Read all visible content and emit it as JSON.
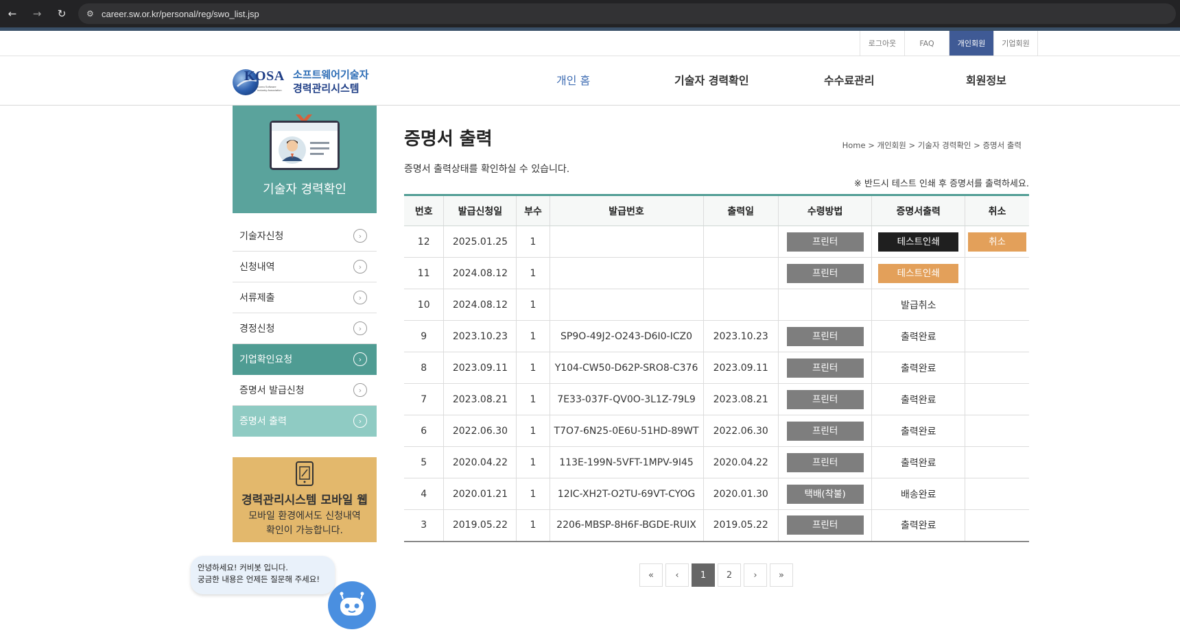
{
  "browser": {
    "back": "←",
    "forward": "→",
    "reload": "↻",
    "url": "career.sw.or.kr/personal/reg/swo_list.jsp"
  },
  "util": [
    {
      "label": "로그아웃",
      "active": false
    },
    {
      "label": "FAQ",
      "active": false
    },
    {
      "label": "개인회원",
      "active": true
    },
    {
      "label": "기업회원",
      "active": false
    }
  ],
  "logo": {
    "kosa": "KOSA",
    "kosa_sub1": "Korea Software",
    "kosa_sub2": "Industry Association",
    "line1": "소프트웨어기술자",
    "line2": "경력관리시스템"
  },
  "gnb": [
    "개인 홈",
    "기술자 경력확인",
    "수수료관리",
    "회원정보"
  ],
  "sidebar": {
    "title": "기술자 경력확인",
    "items": [
      {
        "label": "기술자신청"
      },
      {
        "label": "신청내역"
      },
      {
        "label": "서류제출"
      },
      {
        "label": "경정신청"
      },
      {
        "label": "기업확인요청"
      },
      {
        "label": "증명서 발급신청"
      },
      {
        "label": "증명서 출력"
      }
    ],
    "mobile_title": "경력관리시스템 모바일 웹",
    "mobile_desc1": "모바일 환경에서도 신청내역",
    "mobile_desc2": "확인이 가능합니다."
  },
  "chatbot": {
    "line1": "안녕하세요! 커비봇 입니다.",
    "line2": "궁금한 내용은 언제든 질문해 주세요!"
  },
  "main": {
    "title": "증명서 출력",
    "breadcrumb": "Home > 개인회원 > 기술자 경력확인 > 증명서 출력",
    "desc": "증명서 출력상태를 확인하실 수 있습니다.",
    "notice": "※ 반드시 테스트 인쇄 후 증명서를 출력하세요.",
    "columns": [
      "번호",
      "발급신청일",
      "부수",
      "발급번호",
      "출력일",
      "수령방법",
      "증명서출력",
      "취소"
    ],
    "rows": [
      {
        "no": "12",
        "date": "2025.01.25",
        "qty": "1",
        "issue_no": "",
        "print_date": "",
        "method": "프린터",
        "output": "테스트인쇄",
        "output_style": "black",
        "cancel": "취소"
      },
      {
        "no": "11",
        "date": "2024.08.12",
        "qty": "1",
        "issue_no": "",
        "print_date": "",
        "method": "프린터",
        "output": "테스트인쇄",
        "output_style": "orange",
        "cancel": ""
      },
      {
        "no": "10",
        "date": "2024.08.12",
        "qty": "1",
        "issue_no": "",
        "print_date": "",
        "method": "",
        "output": "발급취소",
        "output_style": "text",
        "cancel": ""
      },
      {
        "no": "9",
        "date": "2023.10.23",
        "qty": "1",
        "issue_no": "SP9O-49J2-O243-D6I0-ICZ0",
        "print_date": "2023.10.23",
        "method": "프린터",
        "output": "출력완료",
        "output_style": "text",
        "cancel": ""
      },
      {
        "no": "8",
        "date": "2023.09.11",
        "qty": "1",
        "issue_no": "Y104-CW50-D62P-SRO8-C376",
        "print_date": "2023.09.11",
        "method": "프린터",
        "output": "출력완료",
        "output_style": "text",
        "cancel": ""
      },
      {
        "no": "7",
        "date": "2023.08.21",
        "qty": "1",
        "issue_no": "7E33-037F-QV0O-3L1Z-79L9",
        "print_date": "2023.08.21",
        "method": "프린터",
        "output": "출력완료",
        "output_style": "text",
        "cancel": ""
      },
      {
        "no": "6",
        "date": "2022.06.30",
        "qty": "1",
        "issue_no": "T7O7-6N25-0E6U-51HD-89WT",
        "print_date": "2022.06.30",
        "method": "프린터",
        "output": "출력완료",
        "output_style": "text",
        "cancel": ""
      },
      {
        "no": "5",
        "date": "2020.04.22",
        "qty": "1",
        "issue_no": "113E-199N-5VFT-1MPV-9I45",
        "print_date": "2020.04.22",
        "method": "프린터",
        "output": "출력완료",
        "output_style": "text",
        "cancel": ""
      },
      {
        "no": "4",
        "date": "2020.01.21",
        "qty": "1",
        "issue_no": "12IC-XH2T-O2TU-69VT-CYOG",
        "print_date": "2020.01.30",
        "method": "택배(착불)",
        "output": "배송완료",
        "output_style": "text",
        "cancel": ""
      },
      {
        "no": "3",
        "date": "2019.05.22",
        "qty": "1",
        "issue_no": "2206-MBSP-8H6F-BGDE-RUIX",
        "print_date": "2019.05.22",
        "method": "프린터",
        "output": "출력완료",
        "output_style": "text",
        "cancel": ""
      }
    ]
  },
  "pager": {
    "first": "«",
    "prev": "‹",
    "pages": [
      "1",
      "2"
    ],
    "current": "1",
    "next": "›",
    "last": "»"
  },
  "colors": {
    "teal": "#5aa39c",
    "accent_blue": "#3f5a95",
    "orange": "#e3a05a"
  }
}
